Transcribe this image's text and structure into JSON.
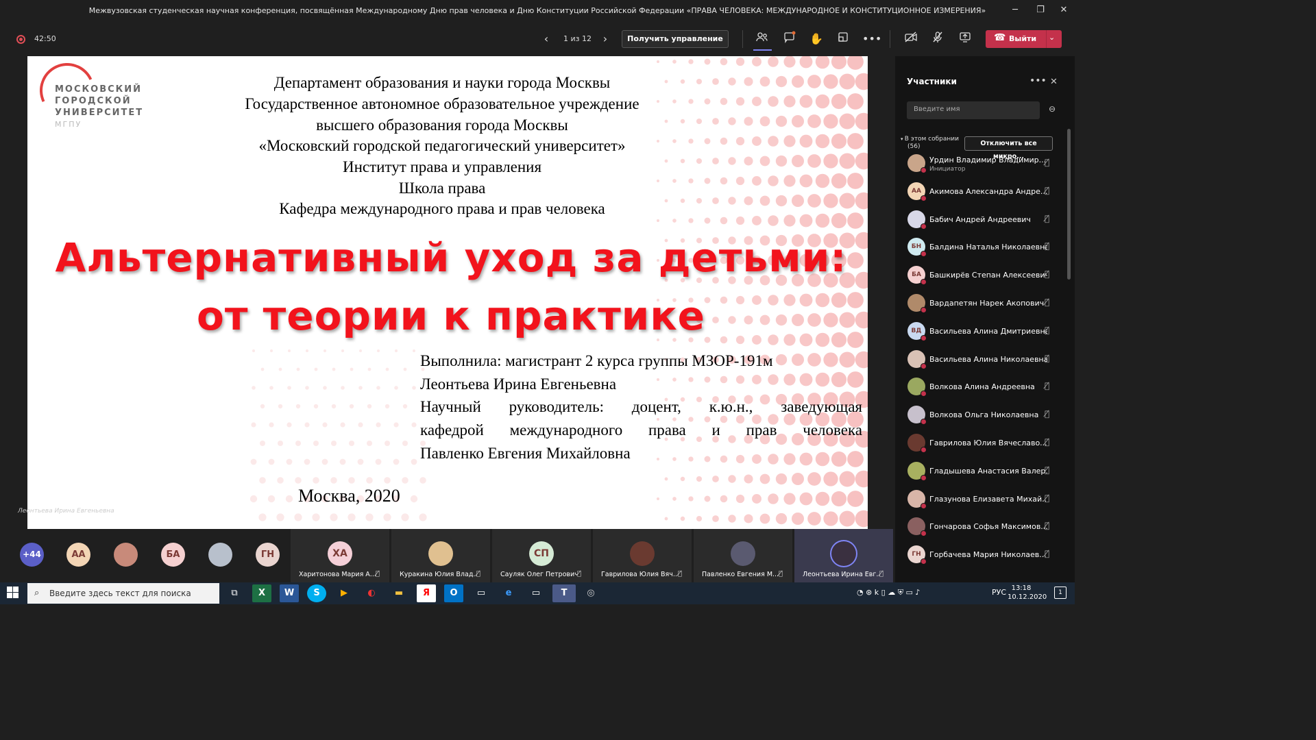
{
  "window": {
    "title": "Межвузовская студенческая научная конференция, посвящённая Международному Дню прав человека и Дню Конституции Российской Федерации «ПРАВА ЧЕЛОВЕКА: МЕЖДУНАРОДНОЕ И КОНСТИТУЦИОННОЕ ИЗМЕРЕНИЯ»"
  },
  "toolbar": {
    "timer": "42:50",
    "pager": "1 из 12",
    "take_control": "Получить управление",
    "leave": "Выйти"
  },
  "slide": {
    "logo_lines": [
      "МОСКОВСКИЙ",
      "ГОРОДСКОЙ",
      "УНИВЕРСИТЕТ"
    ],
    "logo_sub": "МГПУ",
    "header": [
      "Департамент образования и науки города Москвы",
      "Государственное автономное образовательное учреждение",
      "высшего образования города Москвы",
      "«Московский городской педагогический университет»",
      "Институт права и управления",
      "Школа права",
      "Кафедра международного права и прав человека"
    ],
    "title_line1": "Альтернативный уход за детьми:",
    "title_line2": "от теории к практике",
    "author_line1": "Выполнила: магистрант 2 курса группы МЗОР-191м",
    "author_line2": "Леонтьева Ирина Евгеньевна",
    "advisor_line1": "Научный руководитель: доцент, к.ю.н., заведующая",
    "advisor_line2": "кафедрой международного права и прав человека",
    "advisor_line3": "Павленко Евгения Михайловна",
    "city": "Москва, 2020",
    "speaker": "Леонтьева Ирина Евгеньевна"
  },
  "panel": {
    "title": "Участники",
    "search_placeholder": "Введите имя",
    "in_meeting": "В этом собрании",
    "count": "(56)",
    "mute_all": "Отключить все микро...",
    "participants": [
      {
        "name": "Урдин Владимир Владимир...",
        "role": "Инициатор",
        "initials": "",
        "color": "#c9a58a"
      },
      {
        "name": "Акимова Александра Андре...",
        "initials": "АА",
        "color": "#f3d5b5"
      },
      {
        "name": "Бабич Андрей Андреевич",
        "initials": "",
        "color": "#d8d8e8"
      },
      {
        "name": "Балдина Наталья Николаевна",
        "initials": "БН",
        "color": "#cfeaf0"
      },
      {
        "name": "Башкирёв Степан Алексеевич",
        "initials": "БА",
        "color": "#f5d0d0"
      },
      {
        "name": "Вардапетян Нарек Акопович",
        "initials": "",
        "color": "#b08a6a"
      },
      {
        "name": "Васильева Алина Дмитриевна",
        "initials": "ВД",
        "color": "#c9d9f0"
      },
      {
        "name": "Васильева Алина Николаевна",
        "initials": "",
        "color": "#d9c1b5"
      },
      {
        "name": "Волкова Алина Андреевна",
        "initials": "",
        "color": "#9aa860"
      },
      {
        "name": "Волкова Ольга Николаевна",
        "initials": "",
        "color": "#c7c0cc"
      },
      {
        "name": "Гаврилова Юлия Вячеславо...",
        "initials": "",
        "color": "#6a3a30"
      },
      {
        "name": "Гладышева Анастасия Валер...",
        "initials": "",
        "color": "#a8b060"
      },
      {
        "name": "Глазунова Елизавета Михай...",
        "initials": "",
        "color": "#d8b5a8"
      },
      {
        "name": "Гончарова Софья Максимов...",
        "initials": "",
        "color": "#8a6060"
      },
      {
        "name": "Горбачева Мария Николаев...",
        "initials": "ГН",
        "color": "#ead5d0"
      }
    ]
  },
  "gallery": {
    "more": "+44",
    "small": [
      {
        "initials": "АА",
        "color": "#f3d5b5"
      },
      {
        "initials": "",
        "color": "#c88a7a"
      },
      {
        "initials": "БА",
        "color": "#f5d0d0"
      },
      {
        "initials": "",
        "color": "#b8c0cc"
      },
      {
        "initials": "ГН",
        "color": "#ead5d0"
      }
    ],
    "tiles": [
      {
        "name": "Харитонова Мария А...",
        "initials": "ХА",
        "color": "#f5d0d8"
      },
      {
        "name": "Куракина Юлия Влад...",
        "initials": "",
        "color": "#e0c090"
      },
      {
        "name": "Сауляк Олег Петрович",
        "initials": "СП",
        "color": "#d5ead5"
      },
      {
        "name": "Гаврилова Юлия Вяч...",
        "initials": "",
        "color": "#6a3a30"
      },
      {
        "name": "Павленко Евгения М...",
        "initials": "",
        "color": "#5a5a70"
      },
      {
        "name": "Леонтьева Ирина Евг...",
        "initials": "",
        "color": "#3a3040"
      }
    ]
  },
  "taskbar": {
    "search_placeholder": "Введите здесь текст для поиска",
    "lang": "РУС",
    "time": "13:18",
    "date": "10.12.2020",
    "notifications": "1"
  }
}
